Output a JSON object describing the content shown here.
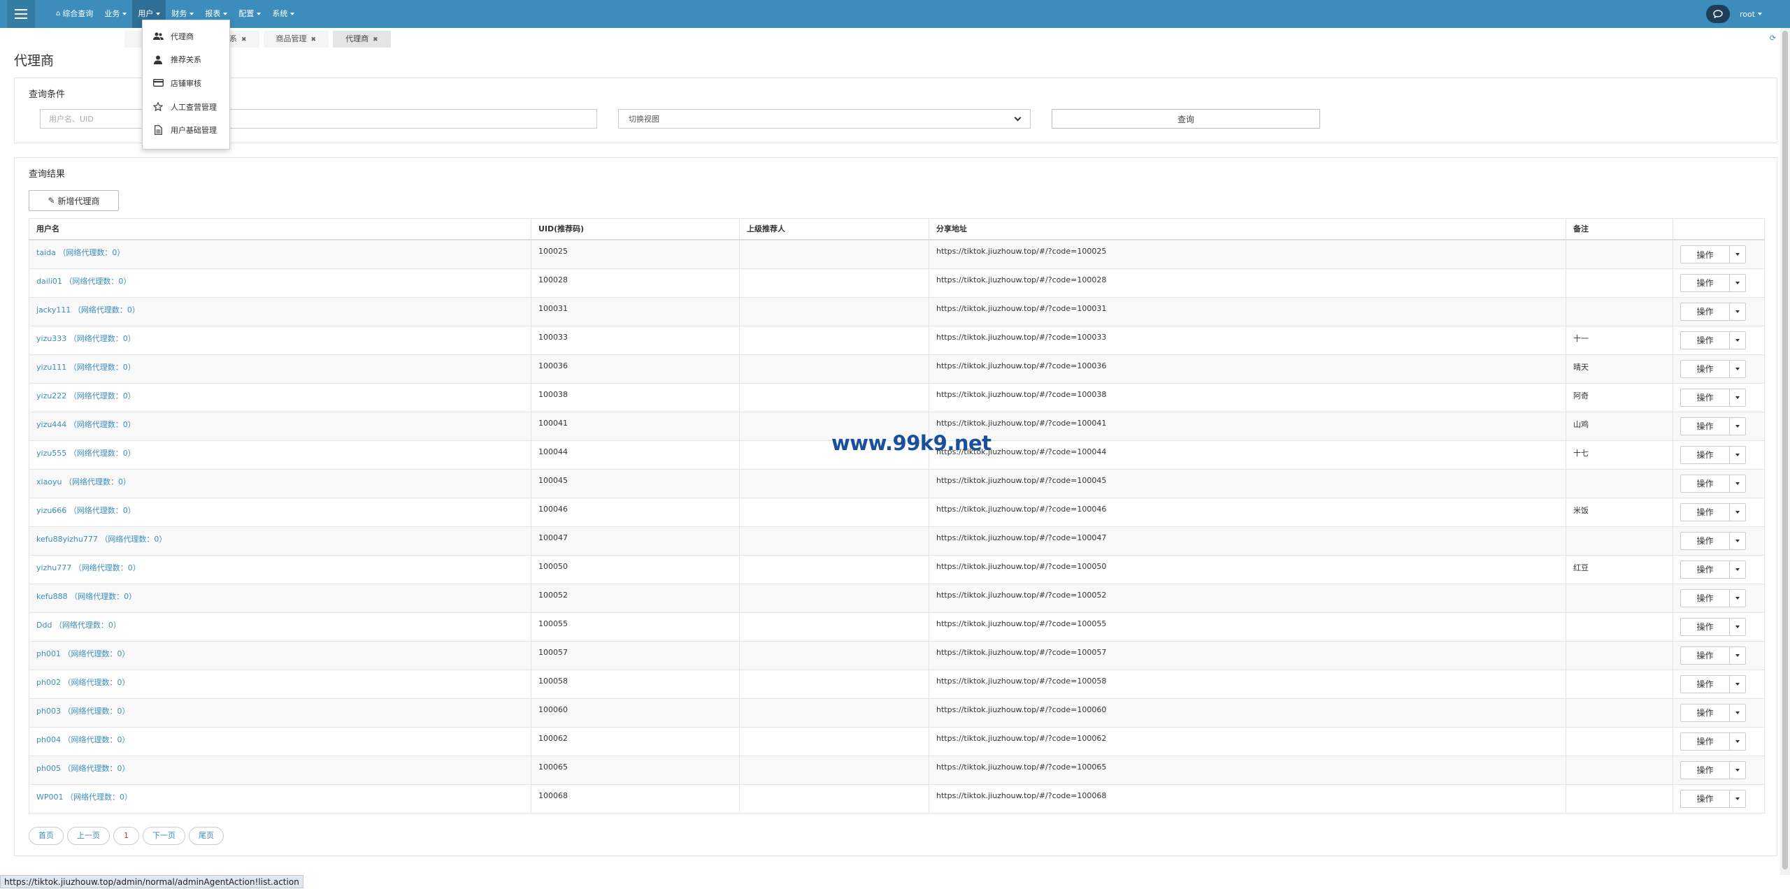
{
  "navbar": {
    "menu": [
      {
        "label": "综合查询",
        "icon": "home-icon",
        "caret": false
      },
      {
        "label": "业务",
        "caret": true
      },
      {
        "label": "用户",
        "caret": true,
        "open": true
      },
      {
        "label": "财务",
        "caret": true
      },
      {
        "label": "报表",
        "caret": true
      },
      {
        "label": "配置",
        "caret": true
      },
      {
        "label": "系统",
        "caret": true
      }
    ],
    "user": "root"
  },
  "dropdown": {
    "items": [
      {
        "label": "代理商",
        "icon": "users-icon"
      },
      {
        "label": "推荐关系",
        "icon": "user-icon"
      },
      {
        "label": "店铺审核",
        "icon": "credit-card-icon"
      },
      {
        "label": "人工查营管理",
        "icon": "star-icon"
      },
      {
        "label": "用户基础管理",
        "icon": "file-text-icon"
      }
    ]
  },
  "tabs": [
    {
      "label": "系",
      "closable": true
    },
    {
      "label": "商品管理",
      "closable": true
    },
    {
      "label": "代理商",
      "closable": true,
      "active": true
    }
  ],
  "page": {
    "title": "代理商"
  },
  "query": {
    "title": "查询条件",
    "input_placeholder": "用户名、UID",
    "select_value": "切换视图",
    "button": "查询"
  },
  "result": {
    "title": "查询结果",
    "add_button": "新增代理商",
    "columns": [
      "用户名",
      "UID(推荐码)",
      "上级推荐人",
      "分享地址",
      "备注",
      ""
    ],
    "op_label": "操作",
    "rows": [
      {
        "name": "taida （网络代理数：0）",
        "uid": "100025",
        "parent": "",
        "url": "https://tiktok.jiuzhouw.top/#/?code=100025",
        "note": ""
      },
      {
        "name": "daili01 （网络代理数：0）",
        "uid": "100028",
        "parent": "",
        "url": "https://tiktok.jiuzhouw.top/#/?code=100028",
        "note": ""
      },
      {
        "name": "jacky111 （网络代理数：0）",
        "uid": "100031",
        "parent": "",
        "url": "https://tiktok.jiuzhouw.top/#/?code=100031",
        "note": ""
      },
      {
        "name": "yizu333 （网络代理数：0）",
        "uid": "100033",
        "parent": "",
        "url": "https://tiktok.jiuzhouw.top/#/?code=100033",
        "note": "十一"
      },
      {
        "name": "yizu111 （网络代理数：0）",
        "uid": "100036",
        "parent": "",
        "url": "https://tiktok.jiuzhouw.top/#/?code=100036",
        "note": "晴天"
      },
      {
        "name": "yizu222 （网络代理数：0）",
        "uid": "100038",
        "parent": "",
        "url": "https://tiktok.jiuzhouw.top/#/?code=100038",
        "note": "阿奇"
      },
      {
        "name": "yizu444 （网络代理数：0）",
        "uid": "100041",
        "parent": "",
        "url": "https://tiktok.jiuzhouw.top/#/?code=100041",
        "note": "山鸡"
      },
      {
        "name": "yizu555 （网络代理数：0）",
        "uid": "100044",
        "parent": "",
        "url": "https://tiktok.jiuzhouw.top/#/?code=100044",
        "note": "十七"
      },
      {
        "name": "xiaoyu （网络代理数：0）",
        "uid": "100045",
        "parent": "",
        "url": "https://tiktok.jiuzhouw.top/#/?code=100045",
        "note": ""
      },
      {
        "name": "yizu666 （网络代理数：0）",
        "uid": "100046",
        "parent": "",
        "url": "https://tiktok.jiuzhouw.top/#/?code=100046",
        "note": "米饭"
      },
      {
        "name": "kefu88yizhu777 （网络代理数：0）",
        "uid": "100047",
        "parent": "",
        "url": "https://tiktok.jiuzhouw.top/#/?code=100047",
        "note": ""
      },
      {
        "name": "yizhu777 （网络代理数：0）",
        "uid": "100050",
        "parent": "",
        "url": "https://tiktok.jiuzhouw.top/#/?code=100050",
        "note": "红豆"
      },
      {
        "name": "kefu888 （网络代理数：0）",
        "uid": "100052",
        "parent": "",
        "url": "https://tiktok.jiuzhouw.top/#/?code=100052",
        "note": ""
      },
      {
        "name": "Ddd （网络代理数：0）",
        "uid": "100055",
        "parent": "",
        "url": "https://tiktok.jiuzhouw.top/#/?code=100055",
        "note": ""
      },
      {
        "name": "ph001 （网络代理数：0）",
        "uid": "100057",
        "parent": "",
        "url": "https://tiktok.jiuzhouw.top/#/?code=100057",
        "note": ""
      },
      {
        "name": "ph002 （网络代理数：0）",
        "uid": "100058",
        "parent": "",
        "url": "https://tiktok.jiuzhouw.top/#/?code=100058",
        "note": ""
      },
      {
        "name": "ph003 （网络代理数：0）",
        "uid": "100060",
        "parent": "",
        "url": "https://tiktok.jiuzhouw.top/#/?code=100060",
        "note": ""
      },
      {
        "name": "ph004 （网络代理数：0）",
        "uid": "100062",
        "parent": "",
        "url": "https://tiktok.jiuzhouw.top/#/?code=100062",
        "note": ""
      },
      {
        "name": "ph005 （网络代理数：0）",
        "uid": "100065",
        "parent": "",
        "url": "https://tiktok.jiuzhouw.top/#/?code=100065",
        "note": ""
      },
      {
        "name": "WP001 （网络代理数：0）",
        "uid": "100068",
        "parent": "",
        "url": "https://tiktok.jiuzhouw.top/#/?code=100068",
        "note": ""
      }
    ]
  },
  "pagination": {
    "first": "首页",
    "prev": "上一页",
    "current": "1",
    "next": "下一页",
    "last": "尾页"
  },
  "watermark": "www.99k9.net",
  "statusbar": "https://tiktok.jiuzhouw.top/admin/normal/adminAgentAction!list.action",
  "colors": {
    "navbar": "#3c8dbc",
    "link": "#3c8dbc",
    "watermark": "#1a4f9c"
  }
}
